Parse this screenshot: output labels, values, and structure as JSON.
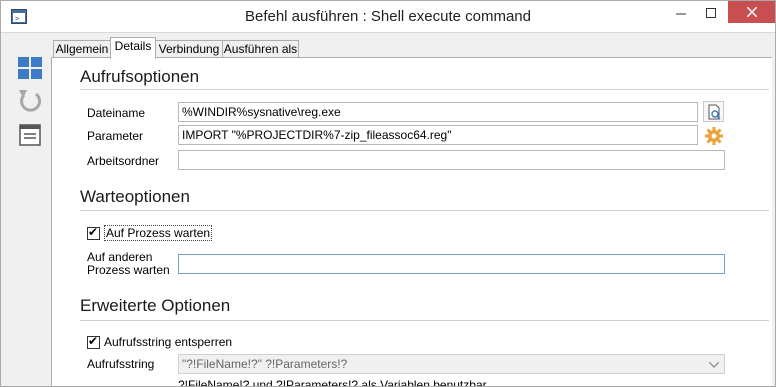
{
  "window": {
    "title": "Befehl ausführen : Shell execute command"
  },
  "tabs": [
    {
      "label": "Allgemein"
    },
    {
      "label": "Details"
    },
    {
      "label": "Verbindung"
    },
    {
      "label": "Ausführen als"
    }
  ],
  "sections": {
    "call_options": "Aufrufsoptionen",
    "wait_options": "Warteoptionen",
    "advanced_options": "Erweiterte Optionen"
  },
  "fields": {
    "filename_label": "Dateiname",
    "filename_value": "%WINDIR%sysnative\\reg.exe",
    "parameter_label": "Parameter",
    "parameter_value": "IMPORT \"%PROJECTDIR%7-zip_fileassoc64.reg\"",
    "workdir_label": "Arbeitsordner",
    "workdir_value": "",
    "wait_process_label": "Auf Prozess warten",
    "wait_process_checked": true,
    "wait_other_label_line1": "Auf anderen",
    "wait_other_label_line2": "Prozess warten",
    "wait_other_value": "",
    "unlock_call_label": "Aufrufsstring entsperren",
    "unlock_call_checked": true,
    "call_string_label": "Aufrufsstring",
    "call_string_value": "\"?!FileName!?\" ?!Parameters!?",
    "hint": "?!FileName!? und ?!Parameters!? als Variablen benutzbar"
  },
  "icons": {
    "app": "window-app-icon",
    "toolbar": [
      "grid-icon",
      "undo-icon",
      "properties-icon"
    ],
    "browse": "browse-file-icon",
    "parameter": "gear-icon"
  },
  "colors": {
    "close_button": "#c74f4f",
    "toolbar_icon": "#3e7bc4",
    "gear": "#e8a33a"
  }
}
